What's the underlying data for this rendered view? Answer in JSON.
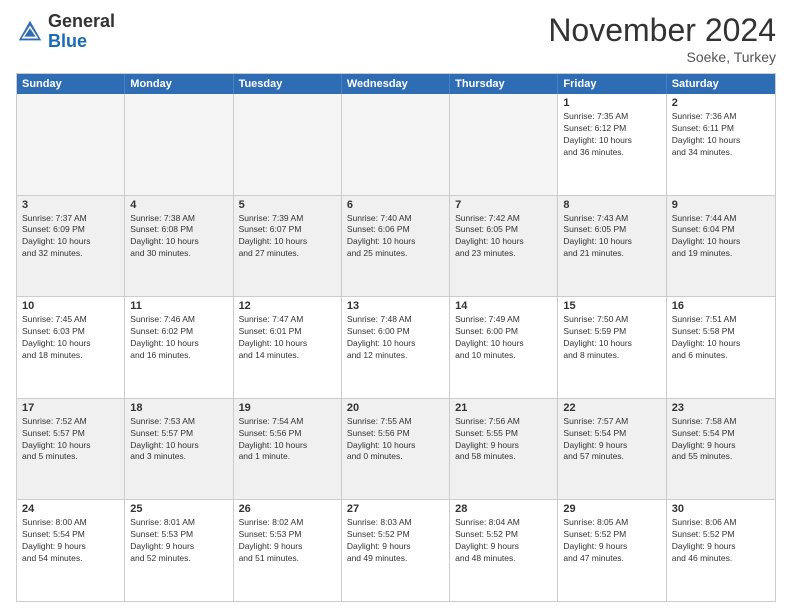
{
  "header": {
    "logo_general": "General",
    "logo_blue": "Blue",
    "month_title": "November 2024",
    "location": "Soeke, Turkey"
  },
  "days_of_week": [
    "Sunday",
    "Monday",
    "Tuesday",
    "Wednesday",
    "Thursday",
    "Friday",
    "Saturday"
  ],
  "weeks": [
    [
      {
        "day": "",
        "info": ""
      },
      {
        "day": "",
        "info": ""
      },
      {
        "day": "",
        "info": ""
      },
      {
        "day": "",
        "info": ""
      },
      {
        "day": "",
        "info": ""
      },
      {
        "day": "1",
        "info": "Sunrise: 7:35 AM\nSunset: 6:12 PM\nDaylight: 10 hours\nand 36 minutes."
      },
      {
        "day": "2",
        "info": "Sunrise: 7:36 AM\nSunset: 6:11 PM\nDaylight: 10 hours\nand 34 minutes."
      }
    ],
    [
      {
        "day": "3",
        "info": "Sunrise: 7:37 AM\nSunset: 6:09 PM\nDaylight: 10 hours\nand 32 minutes."
      },
      {
        "day": "4",
        "info": "Sunrise: 7:38 AM\nSunset: 6:08 PM\nDaylight: 10 hours\nand 30 minutes."
      },
      {
        "day": "5",
        "info": "Sunrise: 7:39 AM\nSunset: 6:07 PM\nDaylight: 10 hours\nand 27 minutes."
      },
      {
        "day": "6",
        "info": "Sunrise: 7:40 AM\nSunset: 6:06 PM\nDaylight: 10 hours\nand 25 minutes."
      },
      {
        "day": "7",
        "info": "Sunrise: 7:42 AM\nSunset: 6:05 PM\nDaylight: 10 hours\nand 23 minutes."
      },
      {
        "day": "8",
        "info": "Sunrise: 7:43 AM\nSunset: 6:05 PM\nDaylight: 10 hours\nand 21 minutes."
      },
      {
        "day": "9",
        "info": "Sunrise: 7:44 AM\nSunset: 6:04 PM\nDaylight: 10 hours\nand 19 minutes."
      }
    ],
    [
      {
        "day": "10",
        "info": "Sunrise: 7:45 AM\nSunset: 6:03 PM\nDaylight: 10 hours\nand 18 minutes."
      },
      {
        "day": "11",
        "info": "Sunrise: 7:46 AM\nSunset: 6:02 PM\nDaylight: 10 hours\nand 16 minutes."
      },
      {
        "day": "12",
        "info": "Sunrise: 7:47 AM\nSunset: 6:01 PM\nDaylight: 10 hours\nand 14 minutes."
      },
      {
        "day": "13",
        "info": "Sunrise: 7:48 AM\nSunset: 6:00 PM\nDaylight: 10 hours\nand 12 minutes."
      },
      {
        "day": "14",
        "info": "Sunrise: 7:49 AM\nSunset: 6:00 PM\nDaylight: 10 hours\nand 10 minutes."
      },
      {
        "day": "15",
        "info": "Sunrise: 7:50 AM\nSunset: 5:59 PM\nDaylight: 10 hours\nand 8 minutes."
      },
      {
        "day": "16",
        "info": "Sunrise: 7:51 AM\nSunset: 5:58 PM\nDaylight: 10 hours\nand 6 minutes."
      }
    ],
    [
      {
        "day": "17",
        "info": "Sunrise: 7:52 AM\nSunset: 5:57 PM\nDaylight: 10 hours\nand 5 minutes."
      },
      {
        "day": "18",
        "info": "Sunrise: 7:53 AM\nSunset: 5:57 PM\nDaylight: 10 hours\nand 3 minutes."
      },
      {
        "day": "19",
        "info": "Sunrise: 7:54 AM\nSunset: 5:56 PM\nDaylight: 10 hours\nand 1 minute."
      },
      {
        "day": "20",
        "info": "Sunrise: 7:55 AM\nSunset: 5:56 PM\nDaylight: 10 hours\nand 0 minutes."
      },
      {
        "day": "21",
        "info": "Sunrise: 7:56 AM\nSunset: 5:55 PM\nDaylight: 9 hours\nand 58 minutes."
      },
      {
        "day": "22",
        "info": "Sunrise: 7:57 AM\nSunset: 5:54 PM\nDaylight: 9 hours\nand 57 minutes."
      },
      {
        "day": "23",
        "info": "Sunrise: 7:58 AM\nSunset: 5:54 PM\nDaylight: 9 hours\nand 55 minutes."
      }
    ],
    [
      {
        "day": "24",
        "info": "Sunrise: 8:00 AM\nSunset: 5:54 PM\nDaylight: 9 hours\nand 54 minutes."
      },
      {
        "day": "25",
        "info": "Sunrise: 8:01 AM\nSunset: 5:53 PM\nDaylight: 9 hours\nand 52 minutes."
      },
      {
        "day": "26",
        "info": "Sunrise: 8:02 AM\nSunset: 5:53 PM\nDaylight: 9 hours\nand 51 minutes."
      },
      {
        "day": "27",
        "info": "Sunrise: 8:03 AM\nSunset: 5:52 PM\nDaylight: 9 hours\nand 49 minutes."
      },
      {
        "day": "28",
        "info": "Sunrise: 8:04 AM\nSunset: 5:52 PM\nDaylight: 9 hours\nand 48 minutes."
      },
      {
        "day": "29",
        "info": "Sunrise: 8:05 AM\nSunset: 5:52 PM\nDaylight: 9 hours\nand 47 minutes."
      },
      {
        "day": "30",
        "info": "Sunrise: 8:06 AM\nSunset: 5:52 PM\nDaylight: 9 hours\nand 46 minutes."
      }
    ]
  ]
}
